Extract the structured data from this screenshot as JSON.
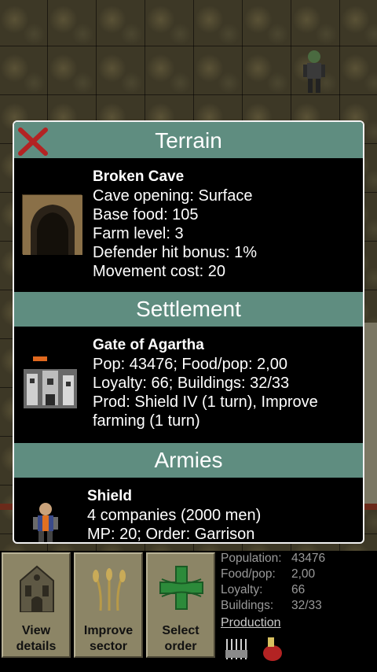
{
  "terrain": {
    "header": "Terrain",
    "name": "Broken Cave",
    "lines": [
      "Cave opening: Surface",
      "Base food: 105",
      "Farm level: 3",
      "Defender hit bonus: 1%",
      "Movement cost: 20"
    ]
  },
  "settlement": {
    "header": "Settlement",
    "name": "Gate of Agartha",
    "lines": [
      "Pop: 43476;  Food/pop: 2,00",
      "Loyalty: 66;  Buildings: 32/33",
      "Prod:  Shield IV (1 turn), Improve farming (1 turn)"
    ]
  },
  "armies": {
    "header": "Armies",
    "name": "Shield",
    "lines": [
      "4 companies (2000 men)",
      "MP: 20;  Order: Garrison"
    ]
  },
  "actions": [
    {
      "label1": "View",
      "label2": "details",
      "icon": "cathedral-icon"
    },
    {
      "label1": "Improve",
      "label2": "sector",
      "icon": "wheat-icon"
    },
    {
      "label1": "Select",
      "label2": "order",
      "icon": "cross-icon"
    }
  ],
  "stats": [
    {
      "key": "Population:",
      "value": "43476"
    },
    {
      "key": "Food/pop:",
      "value": "2,00"
    },
    {
      "key": "Loyalty:",
      "value": "66"
    },
    {
      "key": "Buildings:",
      "value": "32/33"
    }
  ],
  "production_link": "Production",
  "colors": {
    "header_bg": "#5f8d80",
    "close_red": "#b32323",
    "button_bg": "#8c8566",
    "stat_text": "#9a9a9a"
  }
}
